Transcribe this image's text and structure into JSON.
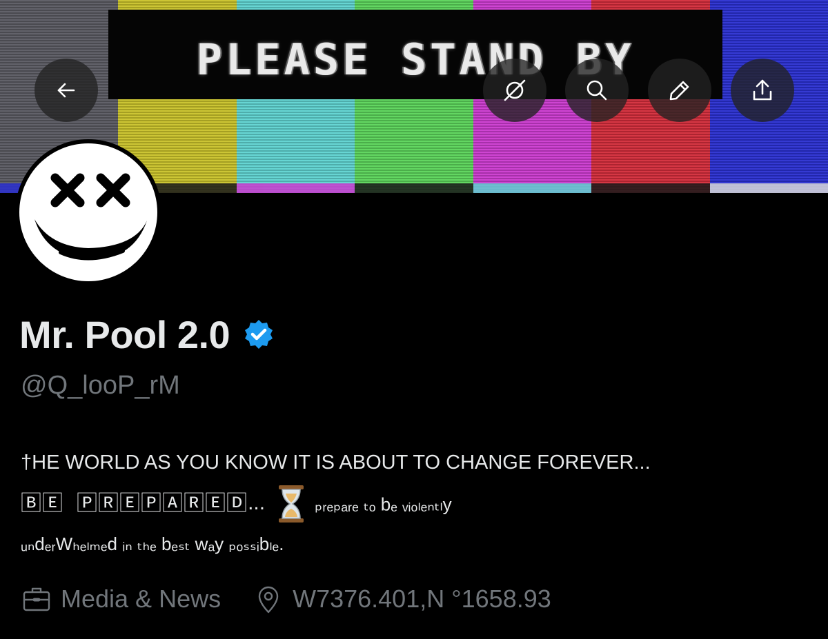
{
  "banner": {
    "overlay_text": "PLEASE STAND BY",
    "bar_colors": [
      "#5a5a62",
      "#c9c22a",
      "#5fd3d1",
      "#5bd45a",
      "#cc3bd0",
      "#d32c3a",
      "#2a2fd1"
    ],
    "strip_colors": [
      "#2a2fd1",
      "#1a1a1a",
      "#cc3bd0",
      "#1a1a1a",
      "#5fd3d1",
      "#1a1a1a",
      "#d9d9d9"
    ]
  },
  "toolbar": {
    "back_icon": "arrow-left-icon",
    "grok_icon": "grok-icon",
    "search_icon": "search-icon",
    "edit_icon": "pencil-icon",
    "share_icon": "share-icon"
  },
  "profile": {
    "display_name": "Mr. Pool 2.0",
    "verified_color": "#1d9bf0",
    "handle": "@Q_looP_rM",
    "bio": {
      "line1": "†HE WORLD AS YOU KNOW IT IS ABOUT TO CHANGE FOREVER...",
      "line2_boxed": "🄱🄴 🄿🅁🄴🄿🄰🅁🄴🄳",
      "line2_ellipsis": "...",
      "line2_tail": "ₚᵣₑₚₐᵣₑ ₜₒ bₑ ᵥᵢₒₗₑₙₜₗy",
      "line3": "ᵤₙdₑᵣWₕₑₗₘₑd ᵢₙ ₜₕₑ bₑₛₜ wₐy ₚₒₛₛᵢbₗₑ."
    },
    "category": "Media & News",
    "location": "W7376.401,N °1658.93"
  },
  "meta_icons": {
    "category": "briefcase-icon",
    "location": "location-pin-icon"
  }
}
